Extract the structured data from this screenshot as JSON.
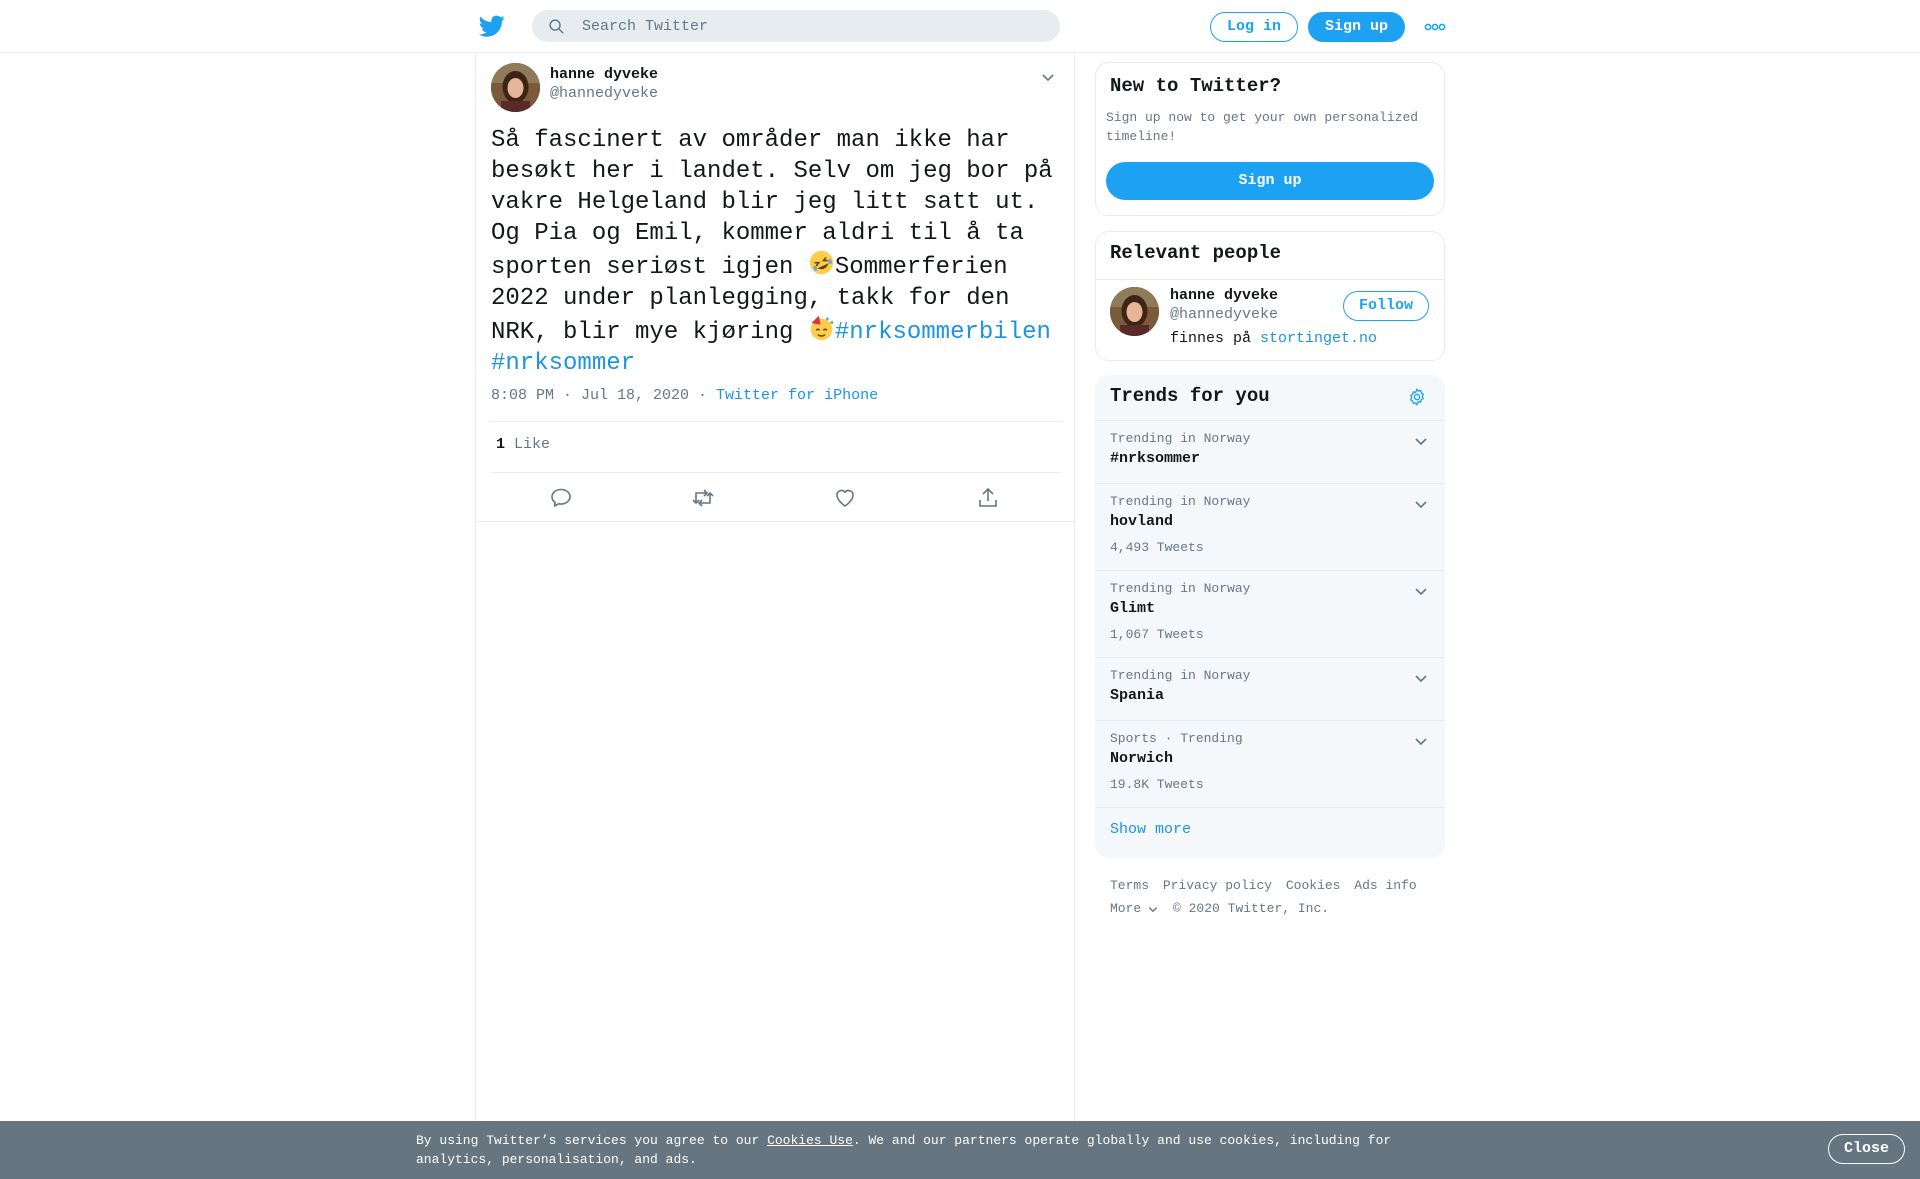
{
  "header": {
    "search_placeholder": "Search Twitter",
    "login_label": "Log in",
    "signup_label": "Sign up"
  },
  "tweet": {
    "author_name": "hanne dyveke",
    "author_handle": "@hannedyveke",
    "text_part1": "Så fascinert av områder man ikke har besøkt her i landet. Selv om jeg bor på vakre Helgeland blir jeg litt satt ut. Og Pia og Emil, kommer aldri til å ta sporten seriøst igjen ",
    "emoji1": "rolling-on-floor-laughing",
    "text_part2": "Sommerferien 2022 under planlegging, takk for den NRK, blir mye kjøring ",
    "emoji2": "partying-face",
    "hashtag1": "#nrksommerbilen",
    "hashtag2": "#nrksommer",
    "timestamp": "8:08 PM · Jul 18, 2020 · ",
    "source": "Twitter for iPhone",
    "like_count": "1",
    "like_label": " Like"
  },
  "sidebar": {
    "new_title": "New to Twitter?",
    "new_subtitle": "Sign up now to get your own personalized timeline!",
    "new_signup_label": "Sign up",
    "relevant_title": "Relevant people",
    "person": {
      "name": "hanne dyveke",
      "handle": "@hannedyveke",
      "bio_prefix": "finnes på ",
      "bio_link": "stortinget.no",
      "follow_label": "Follow"
    },
    "trends_title": "Trends for you",
    "trends": [
      {
        "context": "Trending in Norway",
        "name": "#nrksommer",
        "count": ""
      },
      {
        "context": "Trending in Norway",
        "name": "hovland",
        "count": "4,493 Tweets"
      },
      {
        "context": "Trending in Norway",
        "name": "Glimt",
        "count": "1,067 Tweets"
      },
      {
        "context": "Trending in Norway",
        "name": "Spania",
        "count": ""
      },
      {
        "context": "Sports · Trending",
        "name": "Norwich",
        "count": "19.8K Tweets"
      }
    ],
    "show_more": "Show more"
  },
  "footer": {
    "terms": "Terms",
    "privacy": "Privacy policy",
    "cookies": "Cookies",
    "ads": "Ads info",
    "more": "More",
    "copyright": "© 2020 Twitter, Inc."
  },
  "cookie_bar": {
    "text_before": "By using Twitter’s services you agree to our ",
    "link": "Cookies Use",
    "text_after": ". We and our partners operate globally and use cookies, including for analytics, personalisation, and ads.",
    "close_label": "Close"
  },
  "colors": {
    "brand": "#1da1f2",
    "link": "#1b95e0",
    "secondary_text": "#657786",
    "cookie_bar": "#66757f"
  }
}
